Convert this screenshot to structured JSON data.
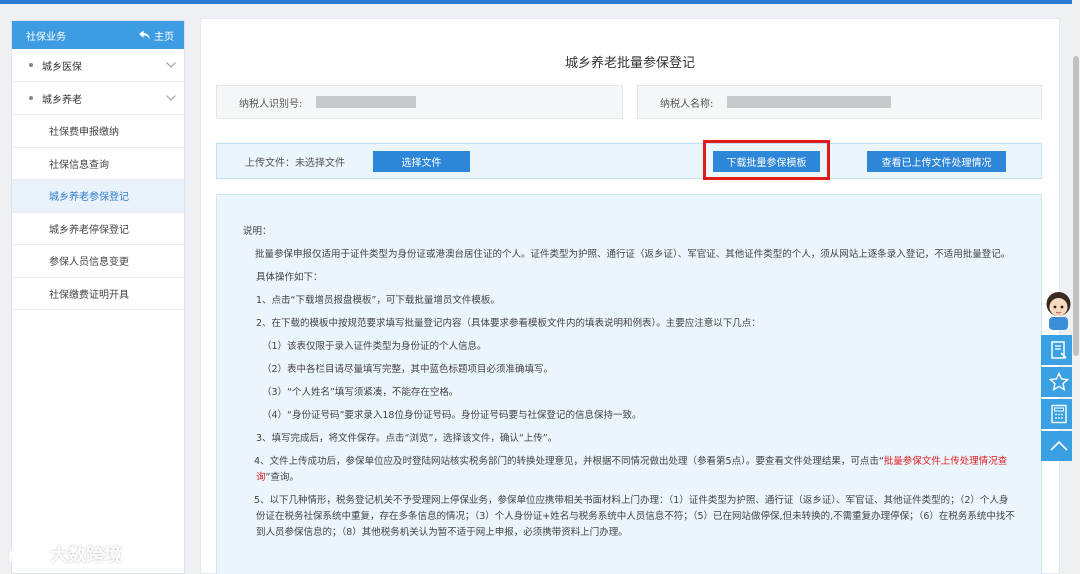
{
  "sidebar": {
    "header": "社保业务",
    "home_label": "主页",
    "groups": [
      {
        "label": "城乡医保"
      },
      {
        "label": "城乡养老"
      }
    ],
    "items": [
      {
        "label": "社保费申报缴纳"
      },
      {
        "label": "社保信息查询"
      },
      {
        "label": "城乡养老参保登记"
      },
      {
        "label": "城乡养老停保登记"
      },
      {
        "label": "参保人员信息变更"
      },
      {
        "label": "社保缴费证明开具"
      }
    ]
  },
  "main": {
    "title": "城乡养老批量参保登记",
    "taxpayer_id_label": "纳税人识别号:",
    "taxpayer_name_label": "纳税人名称:",
    "upload_label": "上传文件：未选择文件",
    "select_file_btn": "选择文件",
    "download_template_btn": "下载批量参保模板",
    "view_status_btn": "查看已上传文件处理情况"
  },
  "instructions": {
    "heading": "说明：",
    "intro": "批量参保申报仅适用于证件类型为身份证或港澳台居住证的个人。证件类型为护照、通行证（返乡证）、军官证、其他证件类型的个人，须从网站上逐条录入登记，不适用批量登记。",
    "steps_title": "具体操作如下：",
    "step1": "1、点击“下载增员报盘模板”，可下载批量增员文件模板。",
    "step2": "2、在下载的模板中按规范要求填写批量登记内容（具体要求参看模板文件内的填表说明和例表）。主要应注意以下几点：",
    "note1": "（1）该表仅限于录入证件类型为身份证的个人信息。",
    "note2": "（2）表中各栏目请尽量填写完整，其中蓝色标题项目必须准确填写。",
    "note3": "（3）“个人姓名”填写须紧凑，不能存在空格。",
    "note4": "（4）“身份证号码”要求录入18位身份证号码。身份证号码要与社保登记的信息保持一致。",
    "step3": "3、填写完成后，将文件保存。点击“浏览”，选择该文件，确认“上传”。",
    "step4_a": "4、文件上传成功后，参保单位应及时登陆网站核实税务部门的转换处理意见，并根据不同情况做出处理（参看第5点）。要查看文件处理结果，可点击“",
    "step4_link": "批量参保文件上传处理情况查询",
    "step4_b": "”查询。",
    "step5": "5、以下几种情形，税务登记机关不予受理网上停保业务，参保单位应携带相关书面材料上门办理：（1）证件类型为护照、通行证（返乡证）、军官证、其他证件类型的；（2）个人身份证在税务社保系统中重复，存在多条信息的情况；（3）个人身份证+姓名与税务系统中人员信息不符；（5）已在网站做停保,但未转换的,不需重复办理停保；（6）在税务系统中找不到人员参保信息的；（8）其他税务机关认为暂不适于网上申报，必须携带资料上门办理。"
  },
  "watermark": "大数跨境",
  "colors": {
    "primary": "#2e86d8",
    "sidebar_header": "#3e9de2",
    "highlight": "#e01b1b",
    "panel_bg": "#eaf5fc"
  }
}
